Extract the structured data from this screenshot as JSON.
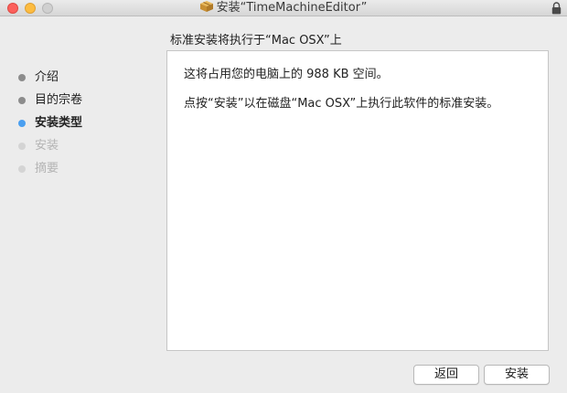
{
  "window": {
    "title": "安装“TimeMachineEditor”",
    "icons": {
      "app": "package-icon",
      "lock": "lock-icon"
    }
  },
  "page": {
    "heading": "标准安装将执行于“Mac OSX”上"
  },
  "sidebar": {
    "steps": [
      {
        "label": "介绍",
        "state": "completed"
      },
      {
        "label": "目的宗卷",
        "state": "completed"
      },
      {
        "label": "安装类型",
        "state": "active"
      },
      {
        "label": "安装",
        "state": "disabled"
      },
      {
        "label": "摘要",
        "state": "disabled"
      }
    ]
  },
  "content": {
    "line1": "这将占用您的电脑上的 988 KB 空间。",
    "line2": "点按“安装”以在磁盘“Mac OSX”上执行此软件的标准安装。"
  },
  "buttons": {
    "back_label": "返回",
    "install_label": "安装"
  },
  "colors": {
    "active_step": "#4a9ff0",
    "close": "#fc605c",
    "minimize": "#fdbc40"
  }
}
